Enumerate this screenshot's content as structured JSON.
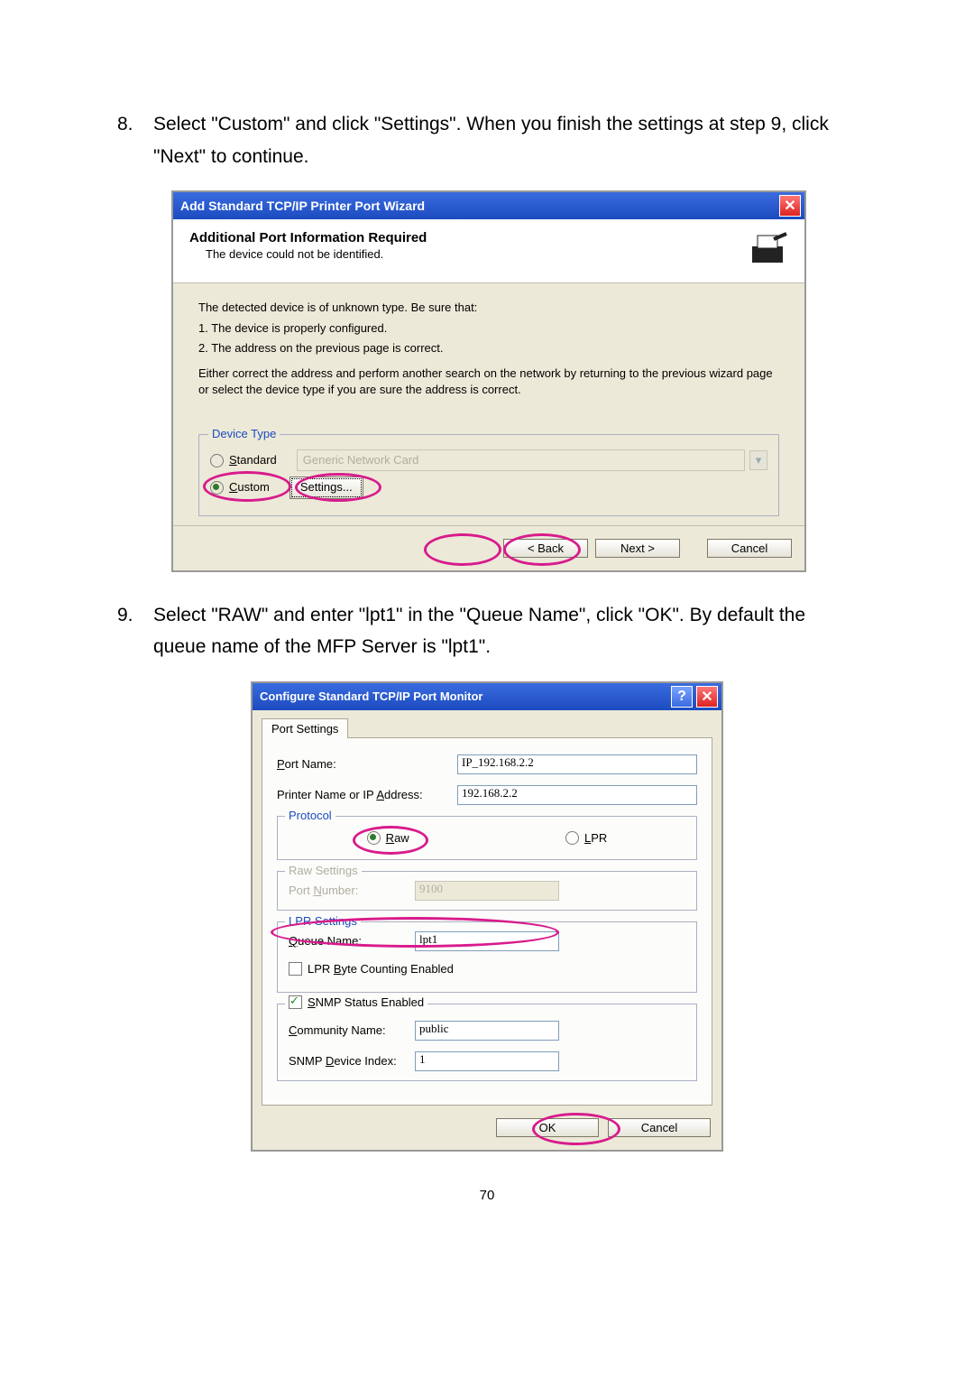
{
  "steps": {
    "s8": {
      "num": "8.",
      "text": "Select \"Custom\" and click \"Settings\". When you finish the settings at step 9, click \"Next\" to continue."
    },
    "s9": {
      "num": "9.",
      "text": "Select \"RAW\" and enter \"lpt1\" in the \"Queue Name\", click \"OK\". By default the queue name of the MFP Server is \"lpt1\"."
    }
  },
  "wiz1": {
    "title": "Add Standard TCP/IP Printer Port Wizard",
    "header_title": "Additional Port Information Required",
    "header_sub": "The device could not be identified.",
    "body_l1": "The detected device is of unknown type.  Be sure that:",
    "body_l2": "1.  The device is properly configured.",
    "body_l3": "2.  The address on the previous page is correct.",
    "body_p": "Either correct the address and perform another search on the network by returning to the previous wizard page or select the device type if you are sure the address is correct.",
    "device_type_legend": "Device Type",
    "standard_label": "Standard",
    "standard_value": "Generic Network Card",
    "custom_label": "Custom",
    "settings_label": "Settings...",
    "back": "< Back",
    "next": "Next >",
    "cancel": "Cancel"
  },
  "wiz2": {
    "title": "Configure Standard TCP/IP Port Monitor",
    "tab": "Port Settings",
    "port_name_label": "Port Name:",
    "port_name_value": "IP_192.168.2.2",
    "printer_label": "Printer Name or IP Address:",
    "printer_value": "192.168.2.2",
    "protocol_legend": "Protocol",
    "raw_label": "Raw",
    "lpr_label": "LPR",
    "raw_settings_legend": "Raw Settings",
    "port_number_label": "Port Number:",
    "port_number_value": "9100",
    "lpr_settings_legend": "LPR Settings",
    "queue_name_label": "Queue Name:",
    "queue_name_value": "lpt1",
    "lpr_byte_label": "LPR Byte Counting Enabled",
    "snmp_status_label": "SNMP Status Enabled",
    "community_label": "Community Name:",
    "community_value": "public",
    "snmp_index_label": "SNMP Device Index:",
    "snmp_index_value": "1",
    "ok": "OK",
    "cancel": "Cancel"
  },
  "page_number": "70"
}
